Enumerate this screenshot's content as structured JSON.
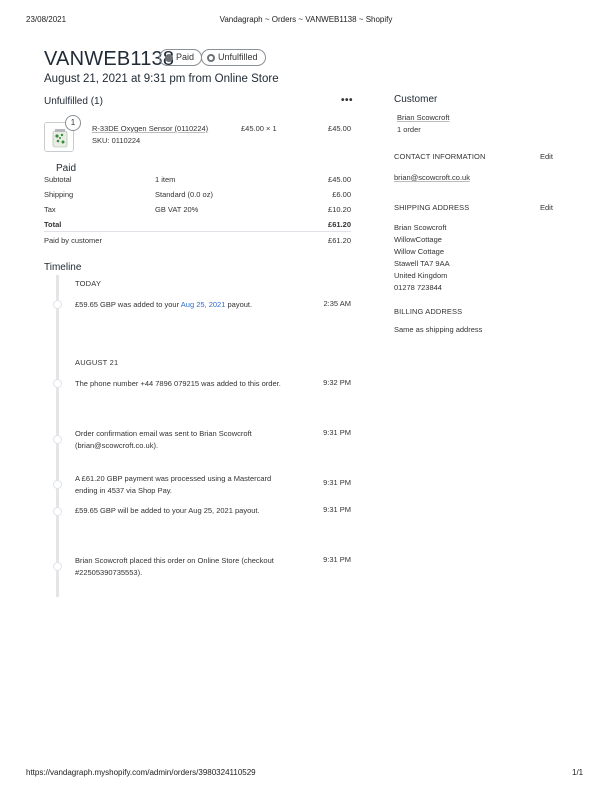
{
  "print_header": {
    "date": "23/08/2021",
    "title": "Vandagraph ~ Orders ~ VANWEB1138 ~ Shopify"
  },
  "print_footer": {
    "url": "https://vandagraph.myshopify.com/admin/orders/3980324110529",
    "page": "1/1"
  },
  "order": {
    "number": "VANWEB1138",
    "payment_badge": "Paid",
    "fulfillment_badge": "Unfulfilled",
    "subtitle": "August 21, 2021 at 9:31 pm from Online Store"
  },
  "unfulfilled": {
    "heading": "Unfulfilled (1)",
    "menu_icon": "more-horizontal-icon",
    "item": {
      "quantity_badge": "1",
      "name": "R-33DE Oxygen Sensor (0110224)",
      "sku": "SKU: 0110224",
      "price_qty": "£45.00 × 1",
      "total": "£45.00"
    }
  },
  "payment": {
    "heading": "Paid",
    "rows": [
      {
        "label": "Subtotal",
        "detail": "1 item",
        "amount": "£45.00"
      },
      {
        "label": "Shipping",
        "detail": "Standard (0.0 oz)",
        "amount": "£6.00"
      },
      {
        "label": "Tax",
        "detail": "GB VAT 20%",
        "amount": "£10.20"
      }
    ],
    "total_label": "Total",
    "total_amount": "£61.20",
    "paid_label": "Paid by customer",
    "paid_amount": "£61.20"
  },
  "timeline": {
    "heading": "Timeline",
    "today_label": "TODAY",
    "aug_label": "AUGUST 21",
    "events": [
      {
        "pre": "£59.65 GBP was added to your ",
        "link": "Aug 25, 2021",
        "post": " payout.",
        "time": "2:35 AM"
      },
      {
        "text": "The phone number +44 7896 079215 was added to this order.",
        "time": "9:32 PM"
      },
      {
        "text": "Order confirmation email was sent to Brian Scowcroft (brian@scowcroft.co.uk).",
        "time": "9:31 PM"
      },
      {
        "text": "A £61.20 GBP payment was processed using a Mastercard ending in 4537 via Shop Pay.",
        "time": "9:31 PM"
      },
      {
        "text": "£59.65 GBP will be added to your Aug 25, 2021 payout.",
        "time": "9:31 PM"
      },
      {
        "text": "Brian Scowcroft placed this order on Online Store (checkout #22505390735553).",
        "time": "9:31 PM"
      }
    ]
  },
  "customer": {
    "heading": "Customer",
    "name": "Brian Scowcroft",
    "orders": "1 order",
    "contact_heading": "CONTACT INFORMATION",
    "edit_label": "Edit",
    "email": "brian@scowcroft.co.uk",
    "shipping_heading": "SHIPPING ADDRESS",
    "shipping_lines": [
      "Brian Scowcroft",
      "WillowCottage",
      "Willow Cottage",
      "Stawell TA7 9AA",
      "United Kingdom",
      "01278 723844"
    ],
    "billing_heading": "BILLING ADDRESS",
    "billing_text": "Same as shipping address"
  }
}
